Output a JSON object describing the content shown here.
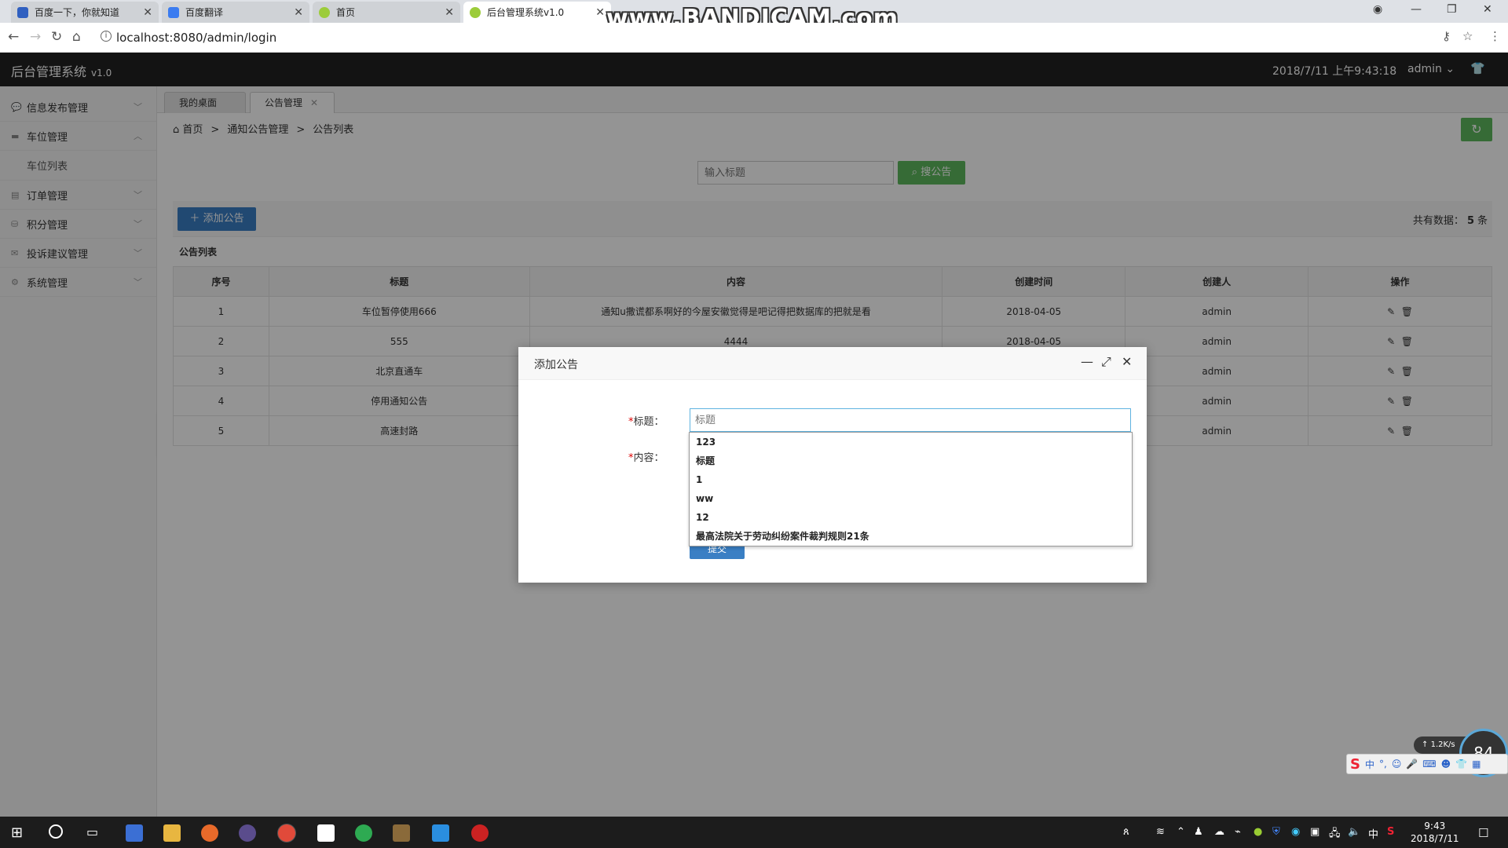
{
  "browser": {
    "tabs": [
      {
        "title": "百度一下，你就知道",
        "favicon_color": "#3060c0"
      },
      {
        "title": "百度翻译",
        "favicon_color": "#3b7cf0"
      },
      {
        "title": "首页",
        "favicon_color": "#9ccc3a"
      },
      {
        "title": "后台管理系统v1.0",
        "favicon_color": "#9ccc3a"
      }
    ],
    "url": "localhost:8080/admin/login",
    "watermark": "www.BANDICAM.com"
  },
  "app": {
    "brand": "后台管理系统",
    "version": "v1.0",
    "datetime": "2018/7/11 上午9:43:18",
    "user": "admin"
  },
  "sidebar": {
    "items": [
      {
        "label": "信息发布管理",
        "icon": "comment-icon",
        "expanded": false
      },
      {
        "label": "车位管理",
        "icon": "car-icon",
        "expanded": true
      },
      {
        "label": "订单管理",
        "icon": "order-icon",
        "expanded": false
      },
      {
        "label": "积分管理",
        "icon": "database-icon",
        "expanded": false
      },
      {
        "label": "投诉建议管理",
        "icon": "mail-icon",
        "expanded": false
      },
      {
        "label": "系统管理",
        "icon": "gear-icon",
        "expanded": false
      }
    ],
    "subitem": "车位列表"
  },
  "content_tabs": [
    {
      "label": "我的桌面"
    },
    {
      "label": "公告管理"
    }
  ],
  "breadcrumb": [
    "首页",
    "通知公告管理",
    "公告列表"
  ],
  "search": {
    "placeholder": "输入标题",
    "button": "搜公告"
  },
  "toolbar": {
    "add_label": "添加公告",
    "total_prefix": "共有数据：",
    "total_count": "5",
    "total_suffix": "条"
  },
  "table": {
    "caption": "公告列表",
    "headers": [
      "序号",
      "标题",
      "内容",
      "创建时间",
      "创建人",
      "操作"
    ],
    "rows": [
      [
        "1",
        "车位暂停使用666",
        "通知u撒谎都系啊好的今屋安徽觉得是吧记得把数据库的把就是看",
        "2018-04-05",
        "admin"
      ],
      [
        "2",
        "555",
        "4444",
        "2018-04-05",
        "admin"
      ],
      [
        "3",
        "北京直通车",
        "",
        "",
        "admin"
      ],
      [
        "4",
        "停用通知公告",
        "",
        "",
        "admin"
      ],
      [
        "5",
        "高速封路",
        "",
        "",
        "admin"
      ]
    ]
  },
  "modal": {
    "title": "添加公告",
    "title_label": "标题：",
    "content_label": "内容：",
    "title_placeholder": "标题",
    "submit_label": "提交",
    "autocomplete": [
      "123",
      "标题",
      "1",
      "ww",
      "12",
      "最高法院关于劳动纠纷案件裁判规则21条"
    ]
  },
  "widgets": {
    "net_speed": "1.2K/s",
    "gauge_value": "84"
  },
  "taskbar": {
    "time": "9:43",
    "date": "2018/7/11",
    "ime_lang": "中"
  },
  "colors": {
    "header_bg": "#222222",
    "primary_green": "#5eb95e",
    "primary_blue": "#3a7fc4"
  }
}
